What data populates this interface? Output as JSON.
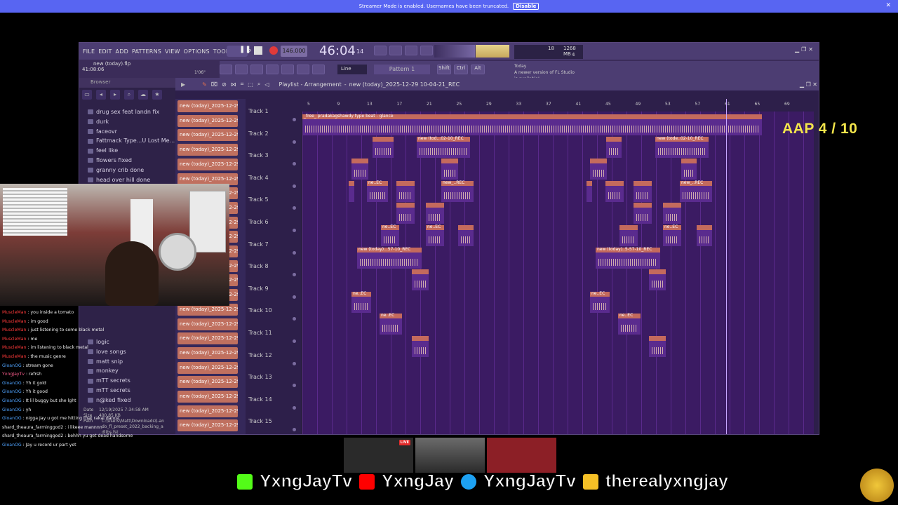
{
  "banner": {
    "text": "Streamer Mode is enabled. Usernames have been truncated.",
    "button": "Disable"
  },
  "fl": {
    "menu": [
      "FILE",
      "EDIT",
      "ADD",
      "PATTERNS",
      "VIEW",
      "OPTIONS",
      "TOOLS",
      "HELP"
    ],
    "tempo": "146.000",
    "time": "46:04",
    "time_sub": "14",
    "song_file": "new (today).flp",
    "song_time": "41:08:06",
    "song_time2": "1'06\"",
    "cpu": "18",
    "ram": "1268 MB",
    "poly": "4",
    "snap": "Line",
    "pattern": "Pattern 1",
    "news_today": "Today",
    "news_text": "A newer version of FL Studio is available!",
    "browser_label": "Browser",
    "browser_items": [
      "drug sex feat landn fix",
      "durk",
      "faceovr",
      "Fattmack Type...U Lost Me...",
      "feel like",
      "flowers fixed",
      "granny crib done",
      "head over hill done"
    ],
    "browser_items2": [
      "logic",
      "love songs",
      "matt snip",
      "monkey",
      "mTT secrets",
      "mTT secrets",
      "n@ked fixed"
    ],
    "file_info": {
      "date_label": "Date",
      "date": "12/19/2025 7:34:58 AM",
      "size_label": "Size",
      "size": "400.85 KB",
      "path_label": "Path",
      "path": "C:\\Users\\Matt\\Downloads\\l-ando_fl_preset_2022_backing_adlibs.fst"
    },
    "playlist_title": "Playlist - Arrangement",
    "playlist_sub": "new (today)_2025-12-29 10-04-21_REC",
    "pattern_label": "new (today)_2025-12-29...",
    "tracks": [
      "Track 1",
      "Track 2",
      "Track 3",
      "Track 4",
      "Track 5",
      "Track 6",
      "Track 7",
      "Track 8",
      "Track 9",
      "Track 10",
      "Track 11",
      "Track 12",
      "Track 13",
      "Track 14",
      "Track 15"
    ],
    "ruler": [
      "5",
      "9",
      "13",
      "17",
      "21",
      "25",
      "29",
      "33",
      "37",
      "41",
      "45",
      "49",
      "53",
      "57",
      "61",
      "65",
      "69"
    ],
    "clip_beat": "_free_ pradakagshawdy type beat - glance",
    "clip_rec": "new (tod...02-10_REC",
    "clip_rec2": "new (tode..02-10_REC",
    "clip_new": "new_..REC",
    "clip_ne": "ne..EC",
    "clip_t7": "new (today)...57-10_REC",
    "clip_t7b": "new (today)..5-57-10_REC"
  },
  "chat": [
    {
      "user": "MuscleMan",
      "msg": "you inside a tomato",
      "c": "r"
    },
    {
      "user": "MuscleMan",
      "msg": "im good",
      "c": "r"
    },
    {
      "user": "MuscleMan",
      "msg": "just listening to some black metal",
      "c": "r"
    },
    {
      "user": "MuscleMan",
      "msg": "me",
      "c": "r"
    },
    {
      "user": "MuscleMan",
      "msg": "im listening to black metal",
      "c": "r"
    },
    {
      "user": "MuscleMan",
      "msg": "the music genre",
      "c": "r"
    },
    {
      "user": "GloanOG",
      "msg": "stream gone",
      "c": "b"
    },
    {
      "user": "YxngJayTv",
      "msg": "refrsh",
      "c": "p"
    },
    {
      "user": "GloanOG",
      "msg": "Yh it gold",
      "c": "b"
    },
    {
      "user": "GloanOG",
      "msg": "Yh it good",
      "c": "b"
    },
    {
      "user": "GloanOG",
      "msg": "It lil buggy but she lght",
      "c": "b"
    },
    {
      "user": "GloanOG",
      "msg": "yh",
      "c": "b"
    },
    {
      "user": "GloanOG",
      "msg": "nigga Jay u got me hitting that rakai dance",
      "c": "b"
    },
    {
      "user": "shard_theaura_farminggod2",
      "msg": "i likeee mannnn",
      "c": "w"
    },
    {
      "user": "shard_theaura_farminggod2",
      "msg": "behhh yu get dead handsome",
      "c": "w"
    },
    {
      "user": "GloanOG",
      "msg": "Jay u record ur part yet",
      "c": "b"
    }
  ],
  "overlay": {
    "aap": "AAP 4 / 10",
    "live": "LIVE",
    "kick": "YxngJayTv",
    "youtube": "YxngJay",
    "twitter": "YxngJayTv",
    "insta": "therealyxngjay",
    "colors": {
      "kick": "#53fc18",
      "youtube": "#ff0000",
      "twitter": "#1da1f2",
      "insta": "#f5c026"
    }
  }
}
